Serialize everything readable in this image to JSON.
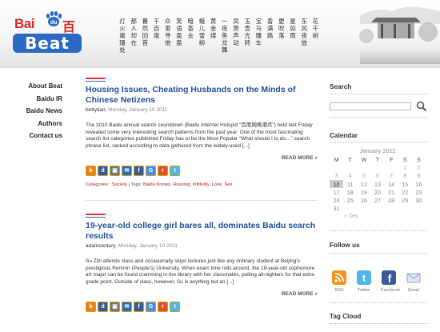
{
  "logo": {
    "baidu": "Bai",
    "du": "du",
    "cn": "百度",
    "beat": "Beat"
  },
  "poem_columns": [
    "灯火阑珊处",
    "那人却在",
    "暮然回首",
    "千百度",
    "众里寻他",
    "笑语盈盈",
    "暗香去",
    "蛾儿雪柳",
    "黄金缕",
    "一夜鱼龙舞",
    "凤箫声动",
    "玉壶光转",
    "宝马雕车",
    "香满路",
    "更吹落",
    "星如雨",
    "东风夜放",
    "花千树"
  ],
  "nav": {
    "items": [
      "About Beat",
      "Baidu IR",
      "Baidu News",
      "Authors",
      "Contact us"
    ]
  },
  "posts": [
    {
      "title": "Housing Issues, Cheating Husbands on the Minds of Chinese Netizens",
      "author": "bettytian",
      "date": ", Monday, January 10 2011",
      "excerpt": "The 2010 Baidu annual search countdown (Baidu Internet Hotspot “百度网络潮点”) held last Friday revealed some very interesting search patterns from the past year. One of the most fascinating search list categories published Friday has to be the Most Popular “What should I to do…” search phrase list, ranked according to data gathered from the widely-used [...]",
      "read_more": "READ MORE »",
      "categories_label": "Categories : Society",
      "tags_label": " | Tags: ",
      "tags": "Baidu Knows, Housing, Infidelity, Love, Sex"
    },
    {
      "title": "19-year-old college girl bares all, dominates Baidu search results",
      "author": "adamcentury",
      "date": ", Monday, January 10 2011",
      "excerpt": "Su Zizi attends class and occasionally skips lectures just like any ordinary student at Beijing's prestigious Renmin (People's) University. When exam time rolls around, the 18-year-old sophomore art major can be found cramming in the library with her classmates, pulling all-nighters for that extra grade point. Outside of class, however, Su is anything but an [...]",
      "read_more": "READ MORE »"
    }
  ],
  "sidebar": {
    "search_title": "Search",
    "search_placeholder": "",
    "calendar_title": "Calendar",
    "calendar": {
      "month": "January 2011",
      "weekdays": [
        "M",
        "T",
        "W",
        "T",
        "F",
        "S",
        "S"
      ],
      "rows": [
        [
          "",
          "",
          "",
          "",
          "",
          "1",
          "2"
        ],
        [
          "3",
          "4",
          "5",
          "6",
          "7",
          "8",
          "9"
        ],
        [
          "10",
          "11",
          "12",
          "13",
          "14",
          "15",
          "16"
        ],
        [
          "17",
          "18",
          "19",
          "20",
          "21",
          "22",
          "23"
        ],
        [
          "24",
          "25",
          "26",
          "27",
          "28",
          "29",
          "30"
        ],
        [
          "31",
          "",
          "",
          "",
          "",
          "",
          ""
        ]
      ],
      "prev": "« Dec"
    },
    "follow_title": "Follow us",
    "follow": [
      {
        "label": "RSS",
        "icon": "rss-icon",
        "color": "#f7941d"
      },
      {
        "label": "Twitter",
        "icon": "twitter-icon",
        "color": "#4fb8e6"
      },
      {
        "label": "Facebook",
        "icon": "facebook-icon",
        "color": "#3b5998"
      },
      {
        "label": "Email",
        "icon": "email-icon",
        "color": "#8ea6c6"
      }
    ],
    "tag_cloud_title": "Tag Cloud"
  },
  "colors": {
    "accent_red": "#d9383a",
    "link_blue": "#1e50a0",
    "brand_blue": "#2a6ac2"
  }
}
